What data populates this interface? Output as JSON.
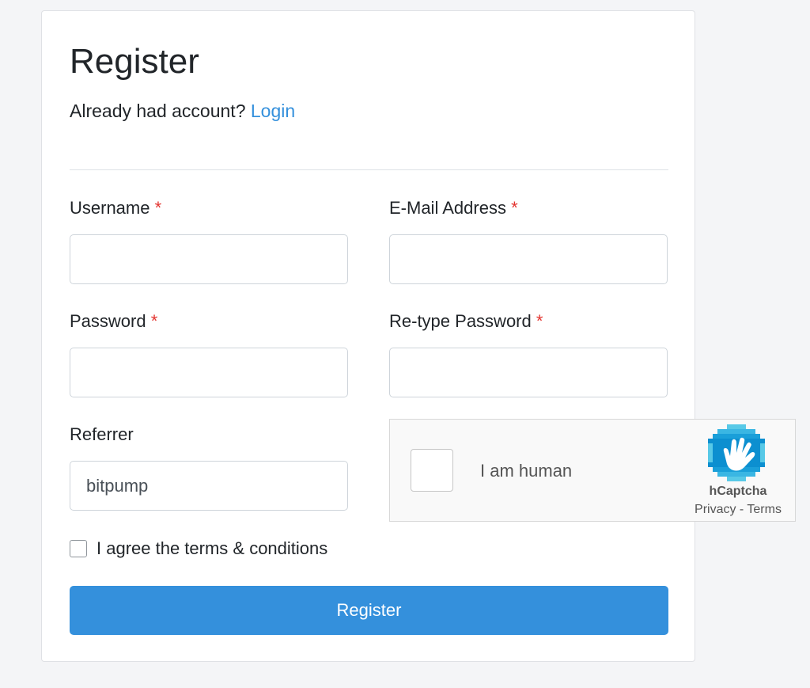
{
  "form": {
    "title": "Register",
    "already_text": "Already had account?",
    "login_link": "Login",
    "required_mark": "*",
    "fields": {
      "username": {
        "label": "Username",
        "value": ""
      },
      "email": {
        "label": "E-Mail Address",
        "value": ""
      },
      "password": {
        "label": "Password",
        "value": ""
      },
      "retype_password": {
        "label": "Re-type Password",
        "value": ""
      },
      "referrer": {
        "label": "Referrer",
        "value": "bitpump"
      }
    },
    "agree_label": "I agree the terms & conditions",
    "submit_label": "Register"
  },
  "captcha": {
    "label": "I am human",
    "brand": "hCaptcha",
    "privacy": "Privacy",
    "separator": " - ",
    "terms": "Terms"
  },
  "colors": {
    "accent": "#3490dc",
    "required": "#e3342f",
    "captcha_logo_light": "#58c9e7",
    "captcha_logo_dark": "#0074bf"
  }
}
